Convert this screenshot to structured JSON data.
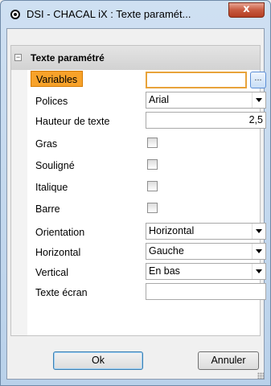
{
  "window": {
    "title": "DSI - CHACAL iX : Texte paramét...",
    "close_glyph": "x"
  },
  "panel": {
    "category_label": "Texte paramétré",
    "collapse_glyph": "−",
    "rows": [
      {
        "label": "Variables",
        "value": "",
        "button": "..."
      },
      {
        "label": "Polices",
        "value": "Arial"
      },
      {
        "label": "Hauteur de texte",
        "value": "2,5"
      },
      {
        "label": "Gras",
        "checked": false
      },
      {
        "label": "Souligné",
        "checked": false
      },
      {
        "label": "Italique",
        "checked": false
      },
      {
        "label": "Barre",
        "checked": false
      },
      {
        "label": "Orientation",
        "value": "Horizontal"
      },
      {
        "label": "Horizontal",
        "value": "Gauche"
      },
      {
        "label": "Vertical",
        "value": "En bas"
      },
      {
        "label": "Texte écran",
        "value": ""
      }
    ]
  },
  "buttons": {
    "ok_label": "Ok",
    "cancel_label": "Annuler"
  }
}
